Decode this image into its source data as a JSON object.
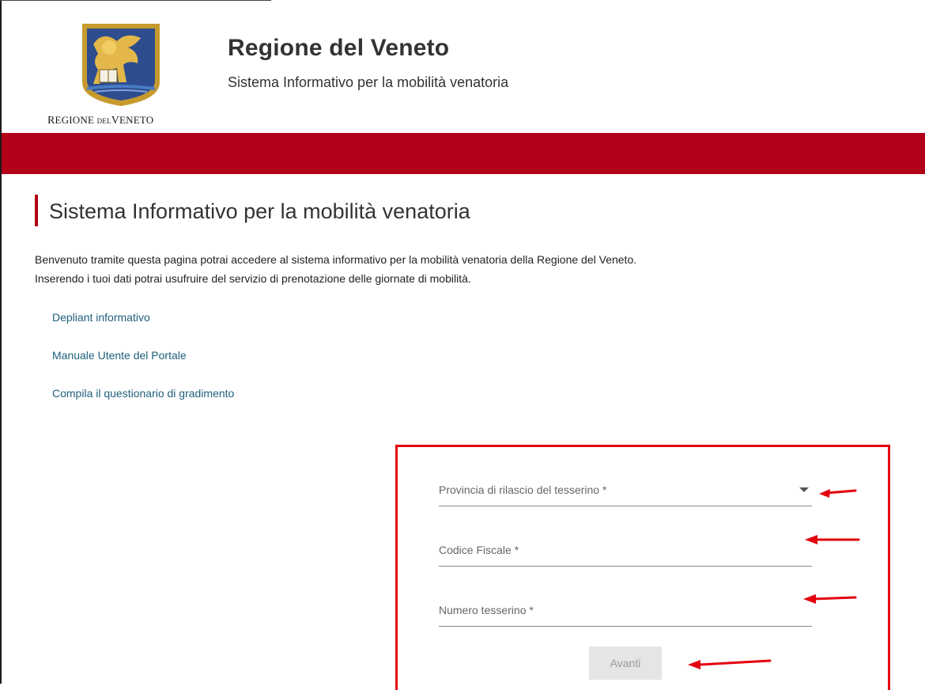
{
  "header": {
    "logo_caption_regione_initial": "R",
    "logo_caption_regione_rest": "EGIONE",
    "logo_caption_del": "DEL",
    "logo_caption_veneto_initial": "V",
    "logo_caption_veneto_rest": "ENETO",
    "title": "Regione del Veneto",
    "subtitle": "Sistema Informativo per la mobilità venatoria"
  },
  "main": {
    "page_title": "Sistema Informativo per la mobilità venatoria",
    "intro_line1": "Benvenuto tramite questa pagina potrai accedere al sistema informativo per la mobilità venatoria della Regione del Veneto.",
    "intro_line2": "Inserendo i tuoi dati potrai usufruire del servizio di prenotazione delle giornate di mobilità.",
    "links": [
      {
        "label": "Depliant informativo"
      },
      {
        "label": "Manuale Utente del Portale"
      },
      {
        "label": "Compila il questionario di gradimento"
      }
    ]
  },
  "form": {
    "provincia_label": "Provincia di rilascio del tesserino *",
    "codice_fiscale_label": "Codice Fiscale *",
    "numero_tesserino_label": "Numero tesserino *",
    "submit_label": "Avanti"
  },
  "colors": {
    "brand_red": "#b10018",
    "annotation_red": "#e3000f",
    "link_blue": "#1f5f7a"
  },
  "icons": {
    "dropdown": "chevron-down-icon",
    "annotation": "arrow-left-icon"
  }
}
